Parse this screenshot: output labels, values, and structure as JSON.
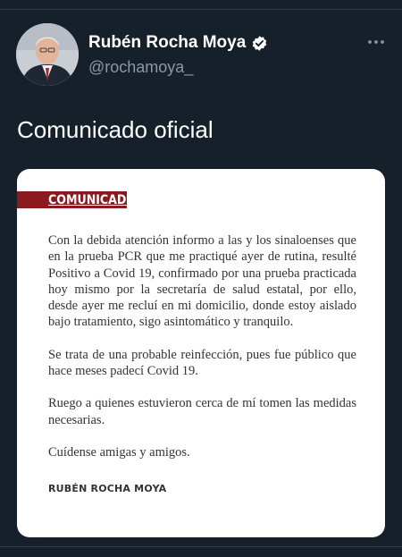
{
  "author": {
    "name": "Rubén Rocha Moya",
    "handle": "@rochamoya_"
  },
  "tweet": {
    "text": "Comunicado oficial"
  },
  "image_card": {
    "header_label": "COMUNICADO",
    "header_color": "#8b1a1f",
    "paragraphs": [
      "Con la debida atención informo a las y los sinaloenses que en la prueba PCR que me practiqué ayer de rutina, resulté Positivo a Covid 19, confirmado por una prueba practicada hoy mismo por la secretaría de salud estatal, por ello, desde ayer me recluí en mi domicilio, donde estoy aislado bajo tratamiento, sigo asintomático y tranquilo.",
      "Se trata de una probable reinfección, pues fue público que hace meses padecí Covid 19.",
      "Ruego a quienes estuvieron cerca de mí tomen las medidas necesarias.",
      "Cuídense amigas y amigos."
    ],
    "signature": "RUBÉN ROCHA MOYA"
  },
  "icons": {
    "verified": "verified-badge-icon",
    "more": "more-options-icon"
  },
  "colors": {
    "background": "#15202b",
    "secondary_text": "#8899a6"
  }
}
